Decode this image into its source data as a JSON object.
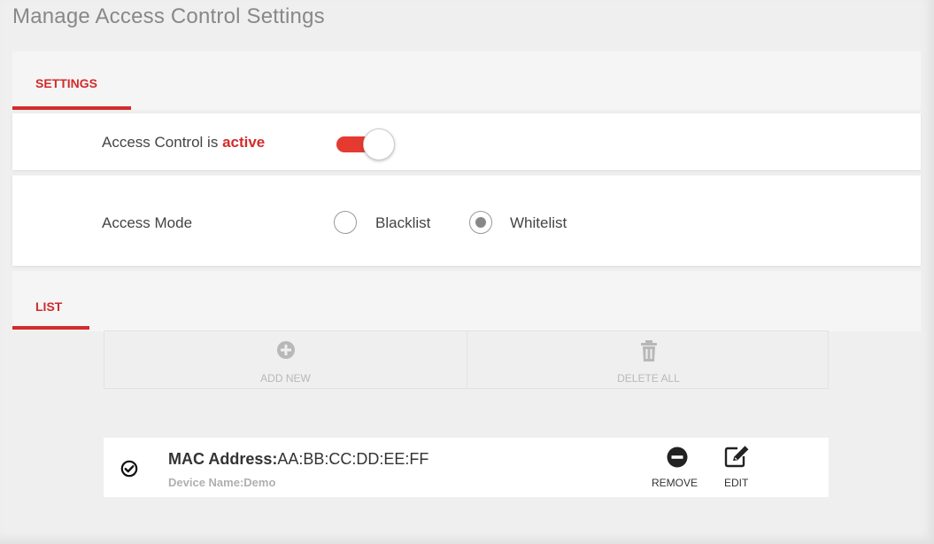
{
  "page": {
    "title": "Manage Access Control Settings"
  },
  "settings_section": {
    "tab_label": "SETTINGS"
  },
  "access_control": {
    "label_prefix": "Access Control is",
    "status_word": "active",
    "enabled": true
  },
  "access_mode": {
    "label": "Access Mode",
    "options": [
      {
        "label": "Blacklist",
        "selected": false
      },
      {
        "label": "Whitelist",
        "selected": true
      }
    ]
  },
  "list_section": {
    "tab_label": "LIST",
    "add_new_label": "ADD NEW",
    "delete_all_label": "DELETE ALL",
    "entries": [
      {
        "mac_label": "MAC Address:",
        "mac_value": "AA:BB:CC:DD:EE:FF",
        "device_label": "Device Name:",
        "device_value": "Demo",
        "remove_label": "REMOVE",
        "edit_label": "EDIT"
      }
    ]
  },
  "colors": {
    "accent": "#d32b2b",
    "toggle_on": "#e53a30"
  },
  "icons": [
    "plus-circle-icon",
    "trash-icon",
    "check-circle-icon",
    "minus-circle-icon",
    "edit-icon"
  ]
}
